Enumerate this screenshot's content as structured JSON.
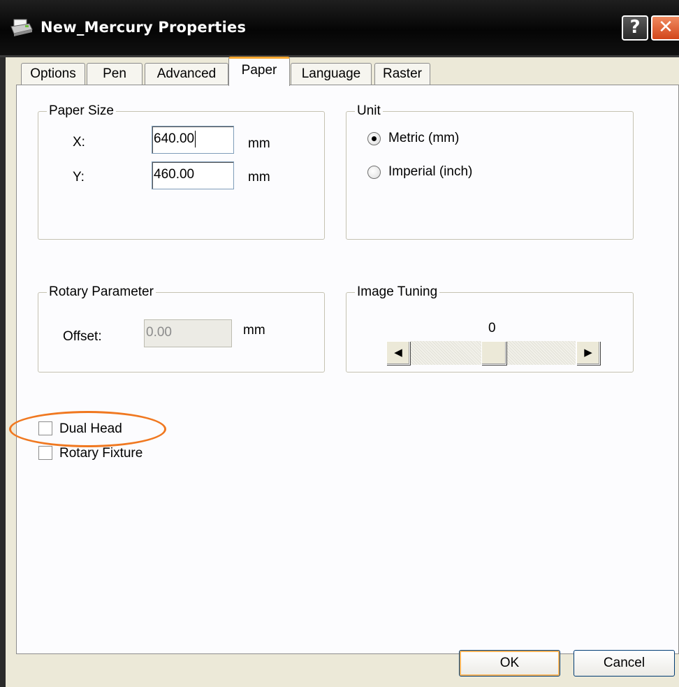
{
  "window": {
    "title": "New_Mercury Properties",
    "help_glyph": "?",
    "close_glyph": "✕"
  },
  "tabs": [
    {
      "label": "Options",
      "active": false
    },
    {
      "label": "Pen",
      "active": false
    },
    {
      "label": "Advanced",
      "active": false
    },
    {
      "label": "Paper",
      "active": true
    },
    {
      "label": "Language",
      "active": false
    },
    {
      "label": "Raster",
      "active": false
    }
  ],
  "paper_size": {
    "label": "Paper Size",
    "x_label": "X:",
    "x_value": "640.00",
    "x_unit": "mm",
    "y_label": "Y:",
    "y_value": "460.00",
    "y_unit": "mm"
  },
  "unit": {
    "label": "Unit",
    "options": [
      {
        "label": "Metric (mm)",
        "selected": true
      },
      {
        "label": "Imperial (inch)",
        "selected": false
      }
    ]
  },
  "rotary_parameter": {
    "label": "Rotary Parameter",
    "offset_label": "Offset:",
    "offset_value": "0.00",
    "offset_unit": "mm"
  },
  "image_tuning": {
    "label": "Image Tuning",
    "value": "0",
    "left_arrow": "◀",
    "right_arrow": "▶"
  },
  "checkboxes": [
    {
      "label": "Dual Head",
      "checked": false
    },
    {
      "label": "Rotary Fixture",
      "checked": false
    }
  ],
  "buttons": {
    "ok": "OK",
    "cancel": "Cancel"
  },
  "colors": {
    "highlight": "#f07820",
    "active_tab_accent": "#f7a830",
    "close_button": "#d2461a"
  }
}
